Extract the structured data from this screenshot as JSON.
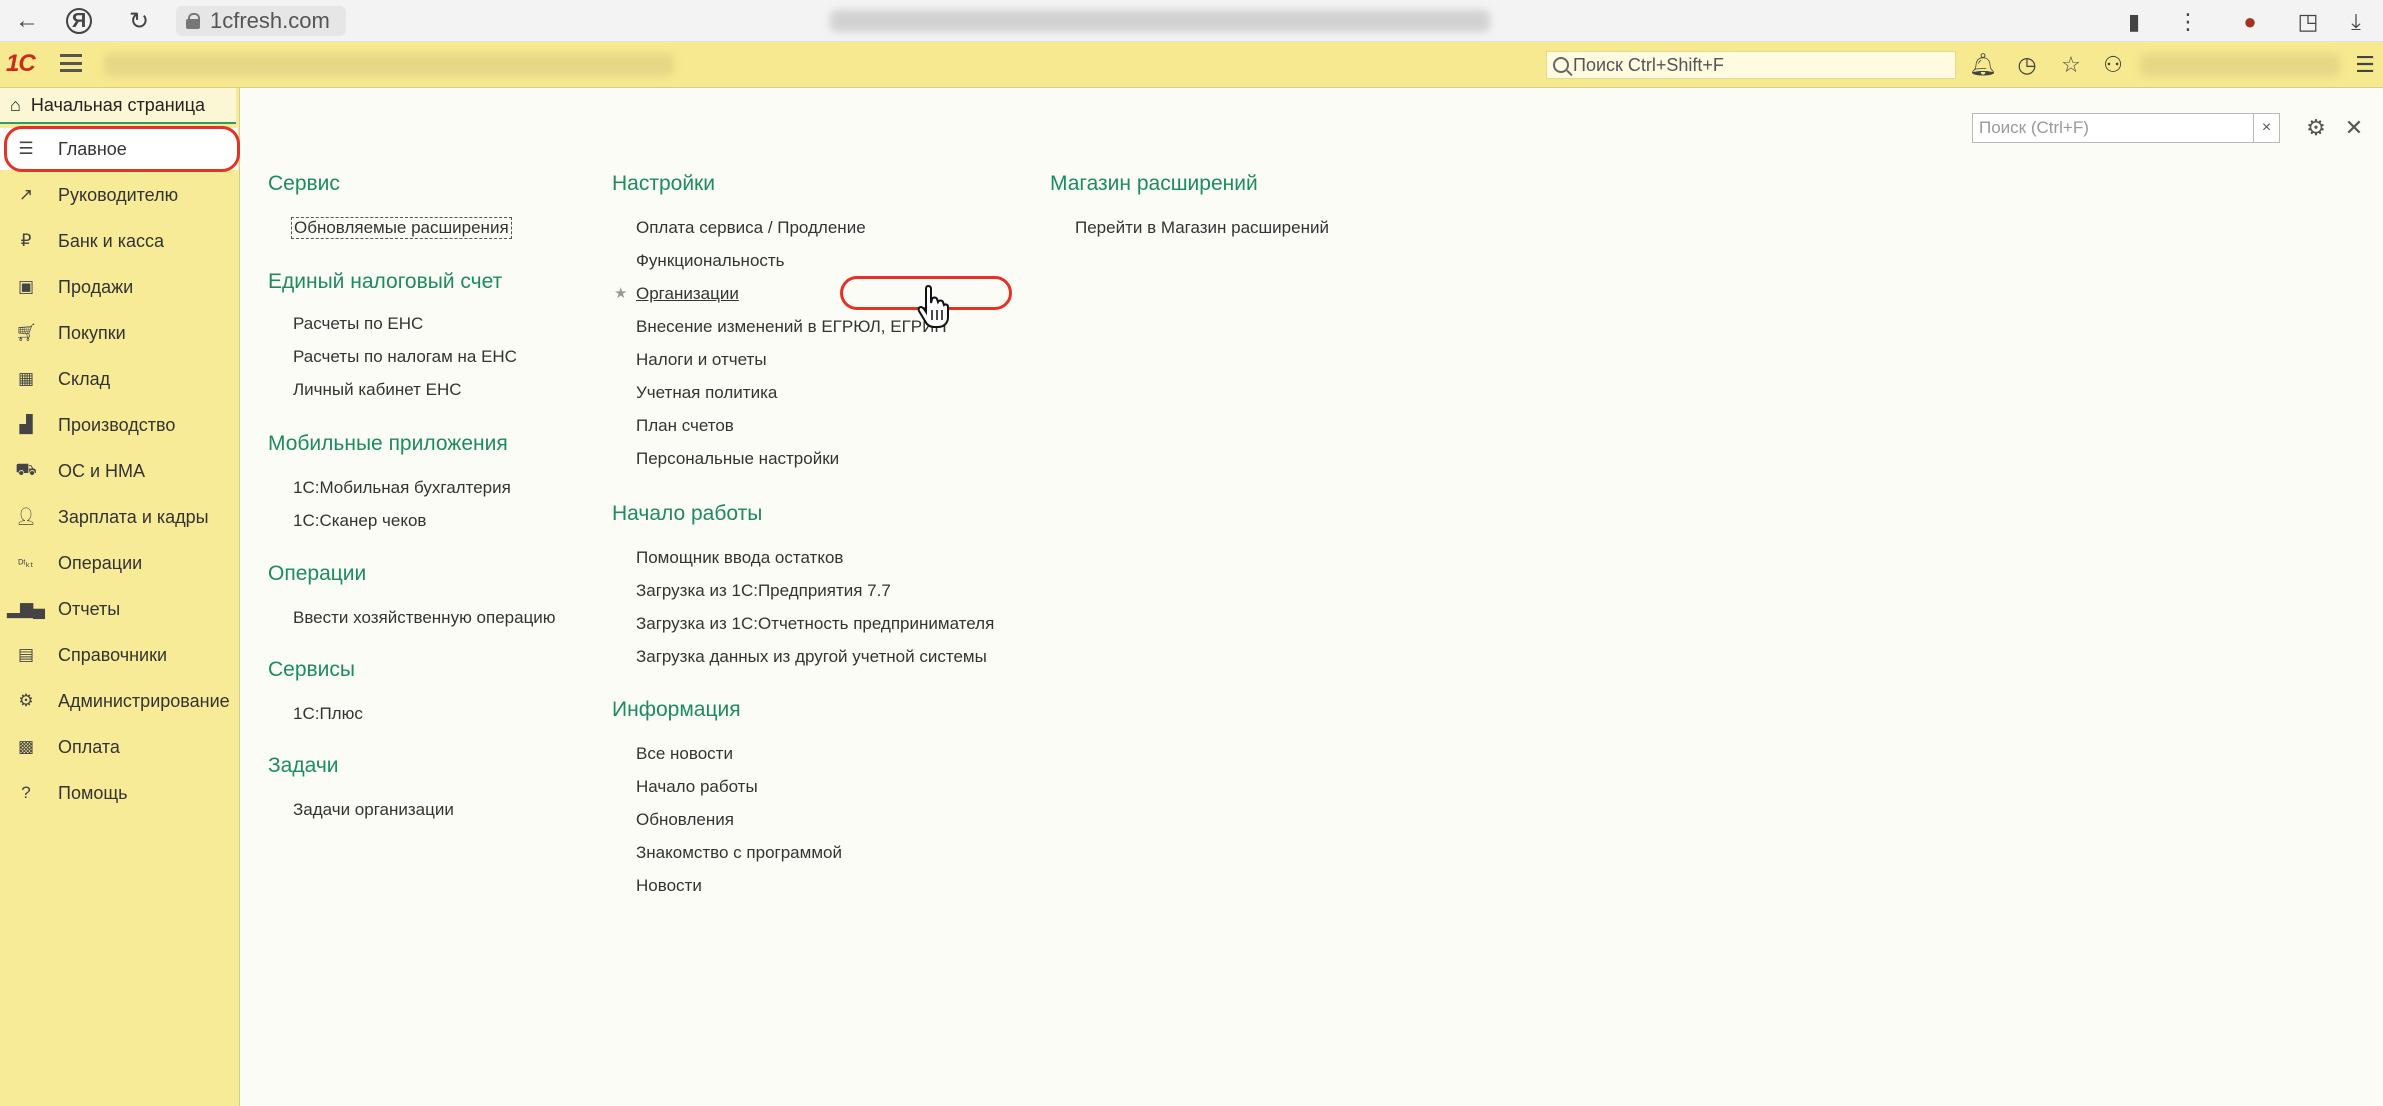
{
  "browser": {
    "url": "1cfresh.com",
    "icons": [
      "back-icon",
      "yandex-icon",
      "reload-icon",
      "lock-icon",
      "bookmark-icon",
      "more-icon",
      "extension-icon",
      "profile-icon",
      "download-icon"
    ]
  },
  "topbar": {
    "logo": "1С",
    "search_placeholder": "Поиск Ctrl+Shift+F"
  },
  "sidebar": {
    "home_label": "Начальная страница",
    "items": [
      {
        "label": "Главное",
        "icon": "menu-lines-icon"
      },
      {
        "label": "Руководителю",
        "icon": "trend-icon"
      },
      {
        "label": "Банк и касса",
        "icon": "ruble-coin-icon"
      },
      {
        "label": "Продажи",
        "icon": "shopping-bag-icon"
      },
      {
        "label": "Покупки",
        "icon": "cart-icon"
      },
      {
        "label": "Склад",
        "icon": "warehouse-icon"
      },
      {
        "label": "Производство",
        "icon": "factory-icon"
      },
      {
        "label": "ОС и НМА",
        "icon": "truck-icon"
      },
      {
        "label": "Зарплата и кадры",
        "icon": "person-icon"
      },
      {
        "label": "Операции",
        "icon": "dt-kt-icon"
      },
      {
        "label": "Отчеты",
        "icon": "bar-chart-icon"
      },
      {
        "label": "Справочники",
        "icon": "books-icon"
      },
      {
        "label": "Администрирование",
        "icon": "gear-icon"
      },
      {
        "label": "Оплата",
        "icon": "wallet-icon"
      },
      {
        "label": "Помощь",
        "icon": "question-icon"
      }
    ]
  },
  "main": {
    "search_placeholder": "Поиск (Ctrl+F)",
    "col1": {
      "service_title": "Сервис",
      "service_link": "Обновляемые расширения",
      "ens_title": "Единый налоговый счет",
      "ens_links": [
        "Расчеты по ЕНС",
        "Расчеты по налогам на ЕНС",
        "Личный кабинет ЕНС"
      ],
      "mobile_title": "Мобильные приложения",
      "mobile_links": [
        "1С:Мобильная бухгалтерия",
        "1С:Сканер чеков"
      ],
      "ops_title": "Операции",
      "ops_link": "Ввести хозяйственную операцию",
      "services_title": "Сервисы",
      "services_link": "1С:Плюс",
      "tasks_title": "Задачи",
      "tasks_link": "Задачи организации"
    },
    "col2": {
      "settings_title": "Настройки",
      "settings_links": [
        "Оплата сервиса / Продление",
        "Функциональность",
        "Организации",
        "Внесение изменений в ЕГРЮЛ, ЕГРИП",
        "Налоги и отчеты",
        "Учетная политика",
        "План счетов",
        "Персональные настройки"
      ],
      "start_title": "Начало работы",
      "start_links": [
        "Помощник ввода остатков",
        "Загрузка из 1С:Предприятия 7.7",
        "Загрузка из 1С:Отчетность предпринимателя",
        "Загрузка данных из другой учетной системы"
      ],
      "info_title": "Информация",
      "info_links": [
        "Все новости",
        "Начало работы",
        "Обновления",
        "Знакомство с программой",
        "Новости"
      ]
    },
    "col3": {
      "store_title": "Магазин расширений",
      "store_link": "Перейти в Магазин расширений"
    }
  }
}
